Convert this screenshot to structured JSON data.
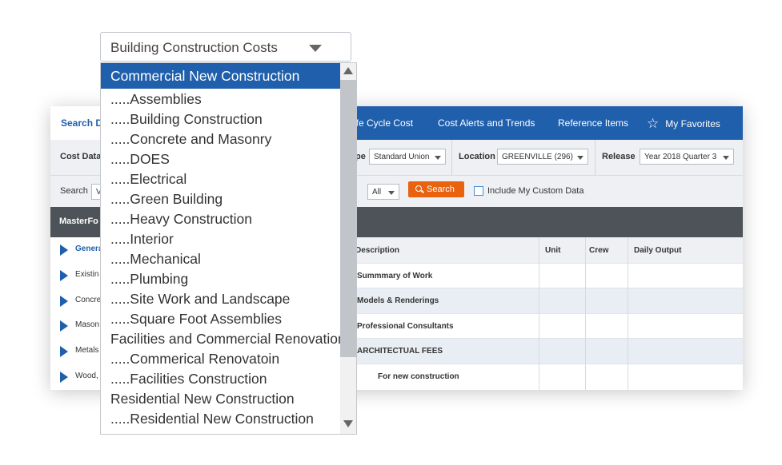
{
  "colors": {
    "nav_blue": "#1f5fac",
    "search_orange": "#e8620f",
    "dark_bar": "#4d5358"
  },
  "nav": {
    "search_tab": "Search D",
    "items": [
      "ife Cycle Cost",
      "Cost Alerts and Trends",
      "Reference Items",
      "My Favorites"
    ]
  },
  "filters": {
    "cost_data_label": "Cost Data",
    "type_label_fragment": "pe",
    "type_value": "Standard Union",
    "location_label": "Location",
    "location_value": "GREENVILLE (296)",
    "release_label": "Release",
    "release_value": "Year 2018 Quarter 3"
  },
  "search": {
    "label": "Search",
    "input_fragment": "V",
    "scope_value": "All",
    "button_label": "Search",
    "custom_data_label": "Include My Custom Data",
    "custom_data_checked": false
  },
  "panel": {
    "title": "MasterFo"
  },
  "tree": [
    "Genera",
    "Existin",
    "Concre",
    "Mason",
    "Metals",
    "Wood,"
  ],
  "table": {
    "headers": [
      "Description",
      "Unit",
      "Crew",
      "Daily Output"
    ],
    "rows": [
      "Summmary of Work",
      "Models & Renderings",
      "Professional Consultants",
      "ARCHITECTUAL FEES",
      "For new construction"
    ]
  },
  "dropdown": {
    "selected_value": "Building Construction Costs",
    "highlighted": "Commercial New Construction",
    "options": [
      ".....Assemblies",
      ".....Building Construction",
      ".....Concrete and Masonry",
      ".....DOES",
      ".....Electrical",
      ".....Green Building",
      ".....Heavy Construction",
      ".....Interior",
      ".....Mechanical",
      ".....Plumbing",
      ".....Site Work and Landscape",
      ".....Square Foot Assemblies",
      "Facilities and Commercial Renovation",
      ".....Commerical Renovatoin",
      ".....Facilities Construction",
      "Residential New Construction",
      ".....Residential New Construction"
    ]
  }
}
